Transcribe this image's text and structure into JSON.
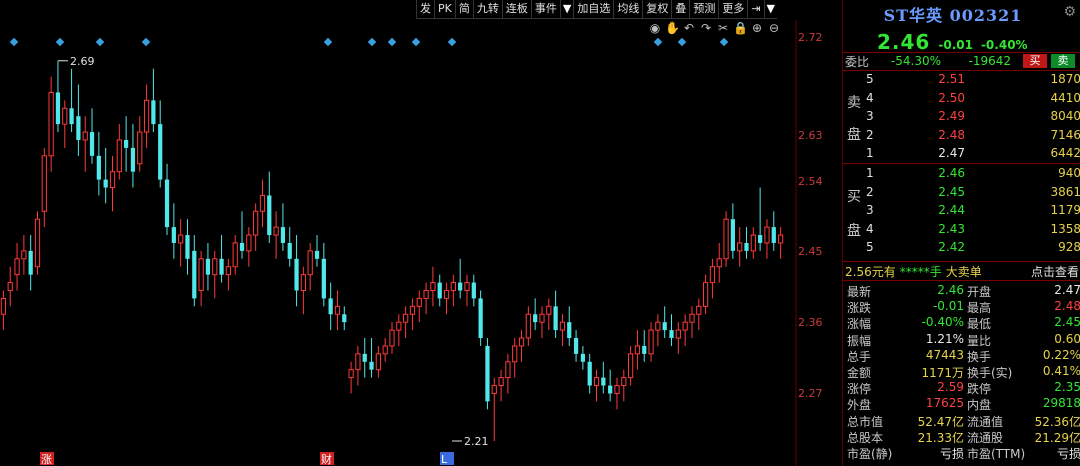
{
  "toolbar": {
    "items": [
      "发",
      "PK",
      "简",
      "九转",
      "连板",
      "事件",
      "▼",
      "加自选",
      "均线",
      "复权",
      "叠",
      "预测",
      "更多",
      "⇥",
      "▼"
    ]
  },
  "tools": [
    "eye-icon",
    "hand-icon",
    "undo-icon",
    "redo-icon",
    "scissors-icon",
    "lock-icon",
    "zoom-in-icon",
    "zoom-out-icon"
  ],
  "tool_glyphs": [
    "◉",
    "✋",
    "↶",
    "↷",
    "✂",
    "🔒",
    "⊕",
    "⊖"
  ],
  "chart": {
    "price_labels": [
      "2.72",
      "2.63",
      "2.54",
      "2.45",
      "2.36",
      "2.27"
    ],
    "high_annotation": "2.69",
    "low_annotation": "2.21",
    "markers": [
      "涨",
      "财",
      "L"
    ],
    "colors": {
      "up": "#ff3a3a",
      "down": "#50e8ea",
      "marker": "#3aa0e0"
    }
  },
  "chart_data": {
    "type": "candlestick",
    "ylim": [
      2.19,
      2.74
    ],
    "candles": [
      [
        2.37,
        2.4,
        2.35,
        2.39
      ],
      [
        2.4,
        2.43,
        2.38,
        2.41
      ],
      [
        2.42,
        2.46,
        2.4,
        2.44
      ],
      [
        2.44,
        2.47,
        2.42,
        2.45
      ],
      [
        2.45,
        2.47,
        2.4,
        2.42
      ],
      [
        2.43,
        2.5,
        2.42,
        2.49
      ],
      [
        2.5,
        2.58,
        2.48,
        2.57
      ],
      [
        2.57,
        2.67,
        2.55,
        2.65
      ],
      [
        2.65,
        2.69,
        2.6,
        2.61
      ],
      [
        2.61,
        2.64,
        2.58,
        2.63
      ],
      [
        2.63,
        2.68,
        2.6,
        2.61
      ],
      [
        2.62,
        2.66,
        2.57,
        2.59
      ],
      [
        2.59,
        2.62,
        2.55,
        2.6
      ],
      [
        2.6,
        2.63,
        2.56,
        2.57
      ],
      [
        2.57,
        2.6,
        2.52,
        2.54
      ],
      [
        2.54,
        2.58,
        2.51,
        2.53
      ],
      [
        2.53,
        2.57,
        2.5,
        2.55
      ],
      [
        2.55,
        2.61,
        2.54,
        2.59
      ],
      [
        2.59,
        2.62,
        2.55,
        2.58
      ],
      [
        2.58,
        2.61,
        2.53,
        2.55
      ],
      [
        2.56,
        2.62,
        2.55,
        2.6
      ],
      [
        2.6,
        2.66,
        2.58,
        2.64
      ],
      [
        2.64,
        2.68,
        2.6,
        2.61
      ],
      [
        2.61,
        2.64,
        2.53,
        2.54
      ],
      [
        2.54,
        2.56,
        2.47,
        2.48
      ],
      [
        2.48,
        2.51,
        2.44,
        2.46
      ],
      [
        2.46,
        2.49,
        2.43,
        2.47
      ],
      [
        2.47,
        2.49,
        2.42,
        2.44
      ],
      [
        2.45,
        2.47,
        2.38,
        2.39
      ],
      [
        2.4,
        2.45,
        2.38,
        2.44
      ],
      [
        2.44,
        2.46,
        2.4,
        2.42
      ],
      [
        2.42,
        2.45,
        2.39,
        2.44
      ],
      [
        2.44,
        2.47,
        2.41,
        2.42
      ],
      [
        2.42,
        2.44,
        2.4,
        2.43
      ],
      [
        2.43,
        2.47,
        2.42,
        2.46
      ],
      [
        2.46,
        2.5,
        2.44,
        2.45
      ],
      [
        2.45,
        2.48,
        2.43,
        2.47
      ],
      [
        2.47,
        2.51,
        2.45,
        2.5
      ],
      [
        2.5,
        2.54,
        2.48,
        2.52
      ],
      [
        2.52,
        2.55,
        2.46,
        2.47
      ],
      [
        2.47,
        2.5,
        2.44,
        2.48
      ],
      [
        2.48,
        2.51,
        2.45,
        2.46
      ],
      [
        2.46,
        2.48,
        2.43,
        2.44
      ],
      [
        2.44,
        2.47,
        2.38,
        2.4
      ],
      [
        2.4,
        2.43,
        2.37,
        2.42
      ],
      [
        2.42,
        2.46,
        2.4,
        2.45
      ],
      [
        2.45,
        2.47,
        2.43,
        2.44
      ],
      [
        2.44,
        2.46,
        2.38,
        2.39
      ],
      [
        2.39,
        2.41,
        2.35,
        2.37
      ],
      [
        2.37,
        2.4,
        2.35,
        2.38
      ],
      [
        2.37,
        2.38,
        2.35,
        2.36
      ],
      [
        2.29,
        2.31,
        2.27,
        2.3
      ],
      [
        2.3,
        2.33,
        2.28,
        2.32
      ],
      [
        2.32,
        2.34,
        2.29,
        2.31
      ],
      [
        2.31,
        2.34,
        2.29,
        2.3
      ],
      [
        2.3,
        2.33,
        2.29,
        2.32
      ],
      [
        2.32,
        2.34,
        2.31,
        2.33
      ],
      [
        2.33,
        2.36,
        2.32,
        2.35
      ],
      [
        2.35,
        2.37,
        2.33,
        2.36
      ],
      [
        2.36,
        2.38,
        2.34,
        2.37
      ],
      [
        2.37,
        2.39,
        2.35,
        2.38
      ],
      [
        2.38,
        2.4,
        2.36,
        2.39
      ],
      [
        2.39,
        2.41,
        2.37,
        2.4
      ],
      [
        2.4,
        2.43,
        2.38,
        2.41
      ],
      [
        2.41,
        2.42,
        2.38,
        2.39
      ],
      [
        2.39,
        2.41,
        2.37,
        2.4
      ],
      [
        2.4,
        2.42,
        2.38,
        2.41
      ],
      [
        2.41,
        2.44,
        2.39,
        2.4
      ],
      [
        2.4,
        2.42,
        2.38,
        2.41
      ],
      [
        2.41,
        2.42,
        2.38,
        2.39
      ],
      [
        2.39,
        2.4,
        2.33,
        2.34
      ],
      [
        2.33,
        2.34,
        2.25,
        2.26
      ],
      [
        2.27,
        2.29,
        2.21,
        2.28
      ],
      [
        2.28,
        2.3,
        2.26,
        2.29
      ],
      [
        2.29,
        2.32,
        2.27,
        2.31
      ],
      [
        2.31,
        2.34,
        2.29,
        2.33
      ],
      [
        2.33,
        2.35,
        2.31,
        2.34
      ],
      [
        2.34,
        2.38,
        2.33,
        2.37
      ],
      [
        2.37,
        2.39,
        2.35,
        2.36
      ],
      [
        2.36,
        2.38,
        2.34,
        2.37
      ],
      [
        2.37,
        2.39,
        2.35,
        2.38
      ],
      [
        2.38,
        2.4,
        2.34,
        2.35
      ],
      [
        2.35,
        2.37,
        2.33,
        2.36
      ],
      [
        2.36,
        2.38,
        2.33,
        2.34
      ],
      [
        2.34,
        2.35,
        2.31,
        2.32
      ],
      [
        2.32,
        2.33,
        2.3,
        2.31
      ],
      [
        2.31,
        2.32,
        2.27,
        2.28
      ],
      [
        2.28,
        2.3,
        2.26,
        2.29
      ],
      [
        2.29,
        2.31,
        2.27,
        2.28
      ],
      [
        2.28,
        2.3,
        2.26,
        2.27
      ],
      [
        2.27,
        2.29,
        2.25,
        2.28
      ],
      [
        2.28,
        2.3,
        2.26,
        2.29
      ],
      [
        2.29,
        2.33,
        2.28,
        2.32
      ],
      [
        2.32,
        2.35,
        2.3,
        2.33
      ],
      [
        2.33,
        2.35,
        2.31,
        2.32
      ],
      [
        2.32,
        2.36,
        2.31,
        2.35
      ],
      [
        2.35,
        2.37,
        2.33,
        2.36
      ],
      [
        2.36,
        2.38,
        2.34,
        2.35
      ],
      [
        2.35,
        2.37,
        2.33,
        2.34
      ],
      [
        2.34,
        2.36,
        2.32,
        2.35
      ],
      [
        2.35,
        2.37,
        2.33,
        2.36
      ],
      [
        2.36,
        2.38,
        2.34,
        2.37
      ],
      [
        2.37,
        2.39,
        2.35,
        2.38
      ],
      [
        2.38,
        2.42,
        2.37,
        2.41
      ],
      [
        2.41,
        2.44,
        2.39,
        2.43
      ],
      [
        2.43,
        2.46,
        2.41,
        2.44
      ],
      [
        2.44,
        2.5,
        2.43,
        2.49
      ],
      [
        2.49,
        2.51,
        2.44,
        2.45
      ],
      [
        2.45,
        2.48,
        2.43,
        2.46
      ],
      [
        2.46,
        2.48,
        2.44,
        2.45
      ],
      [
        2.45,
        2.48,
        2.44,
        2.47
      ],
      [
        2.47,
        2.53,
        2.45,
        2.46
      ],
      [
        2.46,
        2.49,
        2.44,
        2.48
      ],
      [
        2.48,
        2.5,
        2.45,
        2.46
      ],
      [
        2.46,
        2.48,
        2.44,
        2.47
      ]
    ]
  },
  "panel": {
    "title": "ST华英 002321",
    "price": "2.46",
    "change": "-0.01",
    "change_pct": "-0.40%",
    "weibi_label": "委比",
    "weibi_pct": "-54.30%",
    "weibi_val": "-19642",
    "buy_label": "买",
    "sell_label": "卖",
    "sell_side": [
      "卖",
      "盘"
    ],
    "buy_side": [
      "买",
      "盘"
    ],
    "asks": [
      {
        "lv": "5",
        "px": "2.51",
        "vol": "1870",
        "c": "red"
      },
      {
        "lv": "4",
        "px": "2.50",
        "vol": "4410",
        "c": "red"
      },
      {
        "lv": "3",
        "px": "2.49",
        "vol": "8040",
        "c": "red"
      },
      {
        "lv": "2",
        "px": "2.48",
        "vol": "7146",
        "c": "red"
      },
      {
        "lv": "1",
        "px": "2.47",
        "vol": "6442",
        "c": "white"
      }
    ],
    "bids": [
      {
        "lv": "1",
        "px": "2.46",
        "vol": "940",
        "c": "green"
      },
      {
        "lv": "2",
        "px": "2.45",
        "vol": "3861",
        "c": "green"
      },
      {
        "lv": "3",
        "px": "2.44",
        "vol": "1179",
        "c": "green"
      },
      {
        "lv": "4",
        "px": "2.43",
        "vol": "1358",
        "c": "green"
      },
      {
        "lv": "5",
        "px": "2.42",
        "vol": "928",
        "c": "green"
      }
    ],
    "deal": {
      "a": "2.56元有",
      "b": "*****手",
      "c": "大卖单",
      "d": "点击查看"
    },
    "stats": [
      {
        "k1": "最新",
        "v1": "2.46",
        "c1": "green",
        "k2": "开盘",
        "v2": "2.47",
        "c2": "white"
      },
      {
        "k1": "涨跌",
        "v1": "-0.01",
        "c1": "green",
        "k2": "最高",
        "v2": "2.48",
        "c2": "red"
      },
      {
        "k1": "涨幅",
        "v1": "-0.40%",
        "c1": "green",
        "k2": "最低",
        "v2": "2.45",
        "c2": "green"
      },
      {
        "k1": "振幅",
        "v1": "1.21%",
        "c1": "white",
        "k2": "量比",
        "v2": "0.60",
        "c2": "yellow"
      },
      {
        "k1": "总手",
        "v1": "47443",
        "c1": "yellow",
        "k2": "换手",
        "v2": "0.22%",
        "c2": "yellow"
      },
      {
        "k1": "金额",
        "v1": "1171万",
        "c1": "yellow",
        "k2": "换手(实)",
        "v2": "0.41%",
        "c2": "yellow"
      },
      {
        "k1": "涨停",
        "v1": "2.59",
        "c1": "red",
        "k2": "跌停",
        "v2": "2.35",
        "c2": "green"
      },
      {
        "k1": "外盘",
        "v1": "17625",
        "c1": "red",
        "k2": "内盘",
        "v2": "29818",
        "c2": "green"
      },
      {
        "k1": "总市值",
        "v1": "52.47亿",
        "c1": "yellow",
        "k2": "流通值",
        "v2": "52.36亿",
        "c2": "yellow"
      },
      {
        "k1": "总股本",
        "v1": "21.33亿",
        "c1": "yellow",
        "k2": "流通股",
        "v2": "21.29亿",
        "c2": "yellow"
      },
      {
        "k1": "市盈(静)",
        "v1": "亏损",
        "c1": "white",
        "k2": "市盈(TTM)",
        "v2": "亏损",
        "c2": "white"
      }
    ]
  }
}
